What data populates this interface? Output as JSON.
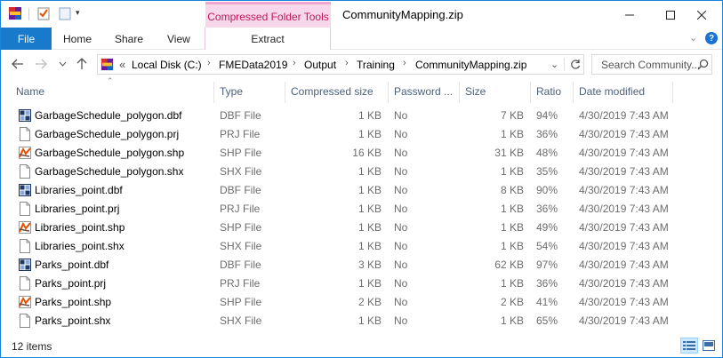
{
  "window": {
    "title": "CommunityMapping.zip",
    "context_group": "Compressed Folder Tools",
    "minimize": "—",
    "maximize": "☐",
    "close": "✕"
  },
  "ribbon": {
    "file": "File",
    "tabs": [
      "Home",
      "Share",
      "View"
    ],
    "context_tab": "Extract"
  },
  "address": {
    "overflow": "«",
    "crumbs": [
      "Local Disk (C:)",
      "FMEData2019",
      "Output",
      "Training",
      "CommunityMapping.zip"
    ],
    "search_placeholder": "Search Community..."
  },
  "columns": [
    "Name",
    "Type",
    "Compressed size",
    "Password ...",
    "Size",
    "Ratio",
    "Date modified"
  ],
  "files": [
    {
      "name": "GarbageSchedule_polygon.dbf",
      "type": "DBF File",
      "compressed": "1 KB",
      "password": "No",
      "size": "7 KB",
      "ratio": "94%",
      "date": "4/30/2019 7:43 AM",
      "icon": "dbf"
    },
    {
      "name": "GarbageSchedule_polygon.prj",
      "type": "PRJ File",
      "compressed": "1 KB",
      "password": "No",
      "size": "1 KB",
      "ratio": "36%",
      "date": "4/30/2019 7:43 AM",
      "icon": "generic"
    },
    {
      "name": "GarbageSchedule_polygon.shp",
      "type": "SHP File",
      "compressed": "16 KB",
      "password": "No",
      "size": "31 KB",
      "ratio": "48%",
      "date": "4/30/2019 7:43 AM",
      "icon": "shp"
    },
    {
      "name": "GarbageSchedule_polygon.shx",
      "type": "SHX File",
      "compressed": "1 KB",
      "password": "No",
      "size": "1 KB",
      "ratio": "35%",
      "date": "4/30/2019 7:43 AM",
      "icon": "generic"
    },
    {
      "name": "Libraries_point.dbf",
      "type": "DBF File",
      "compressed": "1 KB",
      "password": "No",
      "size": "8 KB",
      "ratio": "90%",
      "date": "4/30/2019 7:43 AM",
      "icon": "dbf"
    },
    {
      "name": "Libraries_point.prj",
      "type": "PRJ File",
      "compressed": "1 KB",
      "password": "No",
      "size": "1 KB",
      "ratio": "36%",
      "date": "4/30/2019 7:43 AM",
      "icon": "generic"
    },
    {
      "name": "Libraries_point.shp",
      "type": "SHP File",
      "compressed": "1 KB",
      "password": "No",
      "size": "1 KB",
      "ratio": "49%",
      "date": "4/30/2019 7:43 AM",
      "icon": "shp"
    },
    {
      "name": "Libraries_point.shx",
      "type": "SHX File",
      "compressed": "1 KB",
      "password": "No",
      "size": "1 KB",
      "ratio": "54%",
      "date": "4/30/2019 7:43 AM",
      "icon": "generic"
    },
    {
      "name": "Parks_point.dbf",
      "type": "DBF File",
      "compressed": "3 KB",
      "password": "No",
      "size": "62 KB",
      "ratio": "97%",
      "date": "4/30/2019 7:43 AM",
      "icon": "dbf"
    },
    {
      "name": "Parks_point.prj",
      "type": "PRJ File",
      "compressed": "1 KB",
      "password": "No",
      "size": "1 KB",
      "ratio": "36%",
      "date": "4/30/2019 7:43 AM",
      "icon": "generic"
    },
    {
      "name": "Parks_point.shp",
      "type": "SHP File",
      "compressed": "2 KB",
      "password": "No",
      "size": "2 KB",
      "ratio": "41%",
      "date": "4/30/2019 7:43 AM",
      "icon": "shp"
    },
    {
      "name": "Parks_point.shx",
      "type": "SHX File",
      "compressed": "1 KB",
      "password": "No",
      "size": "1 KB",
      "ratio": "65%",
      "date": "4/30/2019 7:43 AM",
      "icon": "generic"
    }
  ],
  "status": {
    "items": "12 items"
  },
  "colors": {
    "accent": "#1979ca",
    "context": "#c2185b",
    "context_bg": "#f7d7ea"
  }
}
